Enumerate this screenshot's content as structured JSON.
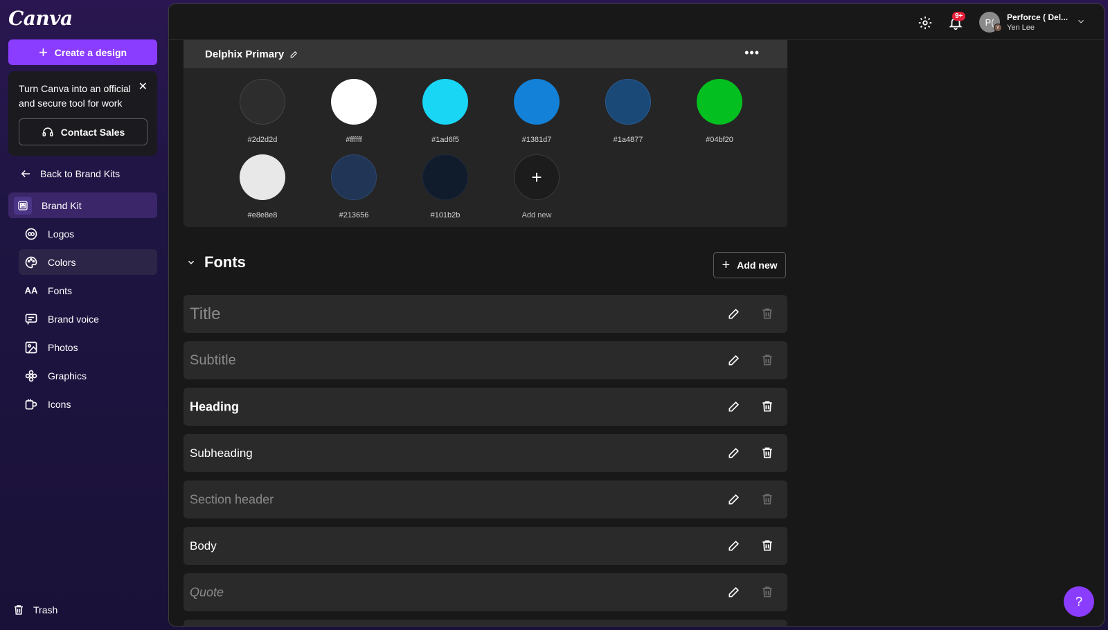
{
  "app": {
    "logo": "Canva"
  },
  "sidebar": {
    "create_label": "Create a design",
    "promo": {
      "text": "Turn Canva into an official and secure tool for work",
      "button": "Contact Sales"
    },
    "back_label": "Back to Brand Kits",
    "brand_kit_label": "Brand Kit",
    "items": [
      {
        "label": "Logos",
        "icon": "logo-icon"
      },
      {
        "label": "Colors",
        "icon": "palette-icon",
        "active": true
      },
      {
        "label": "Fonts",
        "icon": "font-icon"
      },
      {
        "label": "Brand voice",
        "icon": "message-icon"
      },
      {
        "label": "Photos",
        "icon": "image-icon"
      },
      {
        "label": "Graphics",
        "icon": "flower-icon"
      },
      {
        "label": "Icons",
        "icon": "icons-icon"
      }
    ],
    "trash_label": "Trash"
  },
  "topbar": {
    "notification_badge": "9+",
    "avatar_initials": "P(",
    "avatar_sub": "Y",
    "account_name": "Perforce ( Del...",
    "account_user": "Yen Lee"
  },
  "palette": {
    "name": "Delphix Primary",
    "colors": [
      {
        "code": "#2d2d2d",
        "hex": "#2d2d2d"
      },
      {
        "code": "#ffffff",
        "hex": "#ffffff"
      },
      {
        "code": "#1ad6f5",
        "hex": "#1ad6f5"
      },
      {
        "code": "#1381d7",
        "hex": "#1381d7"
      },
      {
        "code": "#1a4877",
        "hex": "#1a4877"
      },
      {
        "code": "#04bf20",
        "hex": "#04bf20"
      },
      {
        "code": "#e8e8e8",
        "hex": "#e8e8e8"
      },
      {
        "code": "#213656",
        "hex": "#213656"
      },
      {
        "code": "#101b2b",
        "hex": "#101b2b"
      }
    ],
    "add_label": "Add new"
  },
  "fonts": {
    "title": "Fonts",
    "add_label": "Add new",
    "rows": [
      {
        "label": "Title"
      },
      {
        "label": "Subtitle"
      },
      {
        "label": "Heading"
      },
      {
        "label": "Subheading"
      },
      {
        "label": "Section header"
      },
      {
        "label": "Body"
      },
      {
        "label": "Quote"
      }
    ]
  },
  "help_label": "?",
  "colors": {
    "accent": "#8b3dff",
    "badge": "#e5203a"
  }
}
